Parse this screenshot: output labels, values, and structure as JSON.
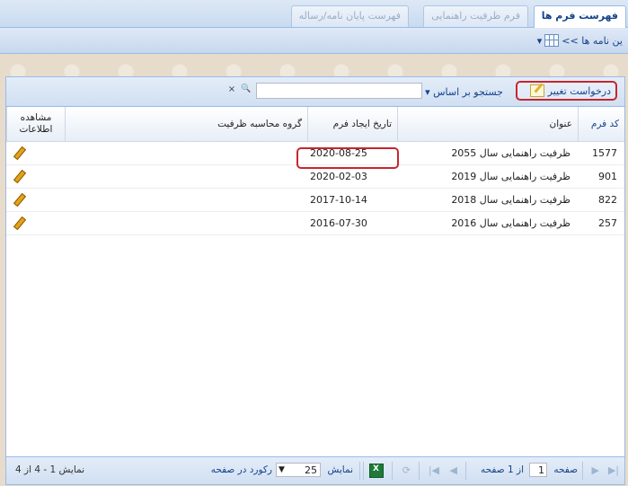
{
  "tabs": [
    {
      "label": "فهرست فرم ها",
      "active": true
    },
    {
      "label": "فرم ظرفیت راهنمایی",
      "active": false
    },
    {
      "label": "فهرست پایان نامه/رساله",
      "active": false
    }
  ],
  "breadcrumb": {
    "text": "ین نامه ها >>",
    "arrow": "▾"
  },
  "toolbar": {
    "request_change_label": "درخواست تغییر",
    "search_by_label": "جستجو بر اساس",
    "search_value": "",
    "clear_icon": "×",
    "search_icon": "🔍"
  },
  "columns": {
    "code": "کد فرم",
    "title": "عنوان",
    "created": "تاریخ ایجاد فرم",
    "group": "گروه محاسبه ظرفیت",
    "view": "مشاهده اطلاعات"
  },
  "rows": [
    {
      "code": "1577",
      "title": "ظرفیت راهنمایی سال 2055",
      "created": "2020-08-25",
      "group": ""
    },
    {
      "code": "901",
      "title": "ظرفیت راهنمایی سال 2019",
      "created": "2020-02-03",
      "group": ""
    },
    {
      "code": "822",
      "title": "ظرفیت راهنمایی سال 2018",
      "created": "2017-10-14",
      "group": ""
    },
    {
      "code": "257",
      "title": "ظرفیت راهنمایی سال 2016",
      "created": "2016-07-30",
      "group": ""
    }
  ],
  "paging": {
    "page_label": "صفحه",
    "page_value": "1",
    "of_pages": "از 1 صفحه",
    "show_label": "نمایش",
    "page_size": "25",
    "records_per_page": "رکورد در صفحه",
    "summary": "نمایش 1 - 4 از 4"
  },
  "colors": {
    "accent": "#15428b",
    "highlight": "#c6262e",
    "border": "#99bbe8"
  }
}
